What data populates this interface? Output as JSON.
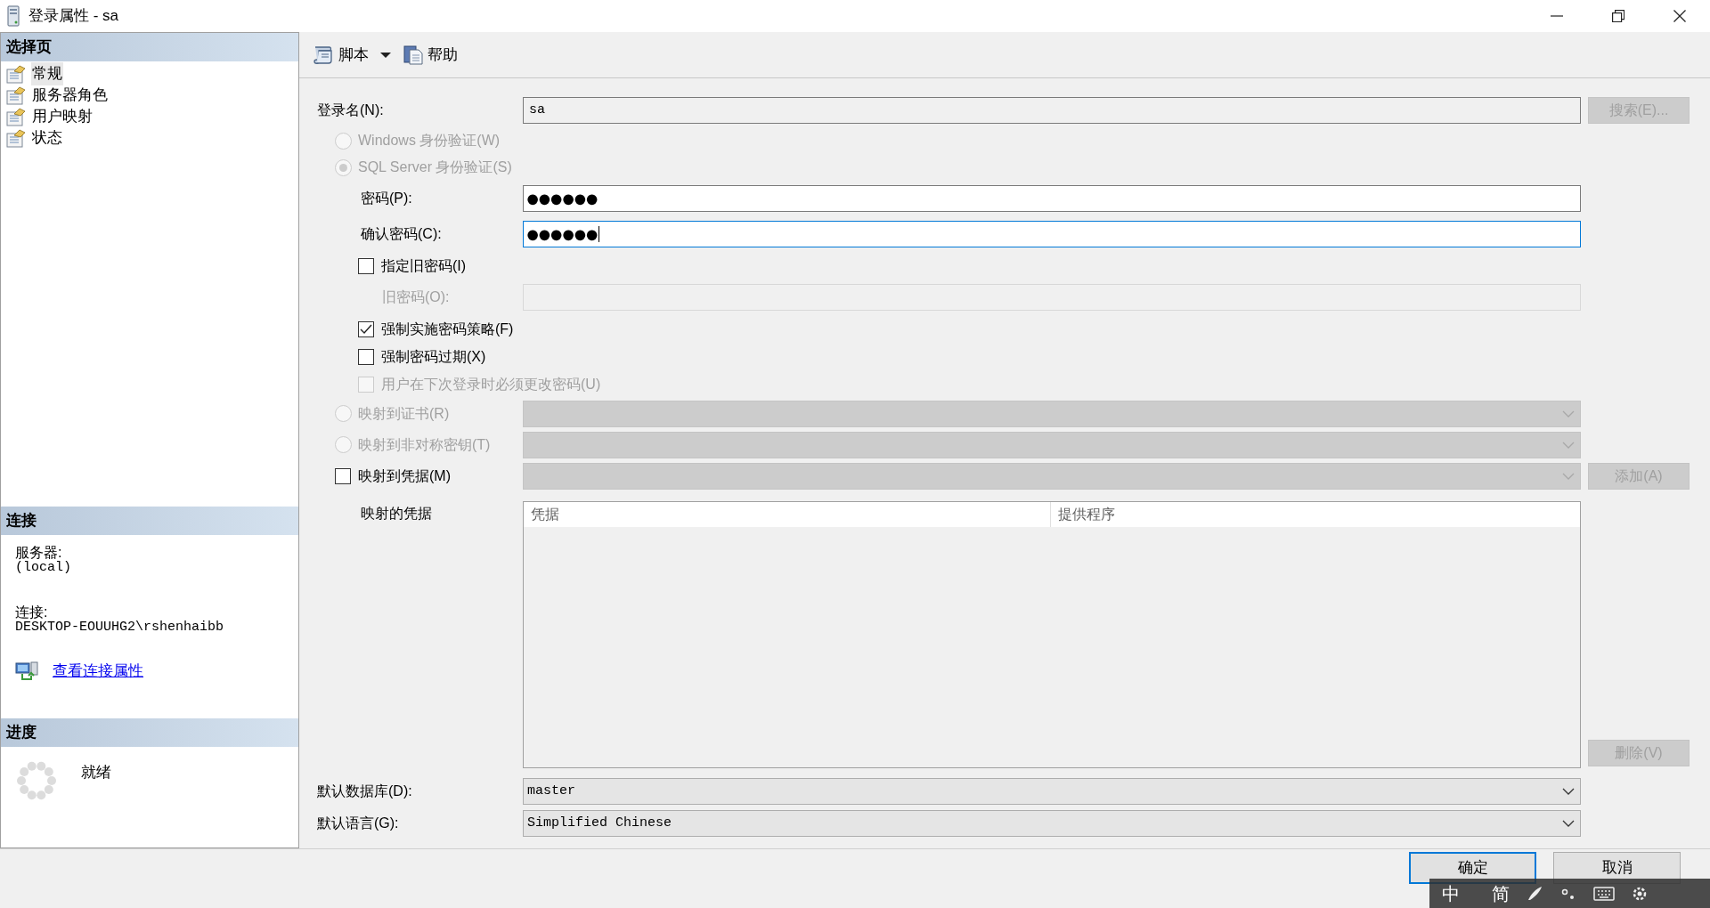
{
  "window": {
    "title": "登录属性 - sa"
  },
  "sidebar": {
    "header": "选择页",
    "pages": [
      {
        "label": "常规",
        "selected": true
      },
      {
        "label": "服务器角色",
        "selected": false
      },
      {
        "label": "用户映射",
        "selected": false
      },
      {
        "label": "状态",
        "selected": false
      }
    ]
  },
  "connection": {
    "header": "连接",
    "server_label": "服务器:",
    "server": "(local)",
    "connection_label": "连接:",
    "connection": "DESKTOP-EOUUHG2\\rshenhaibb",
    "link": "查看连接属性"
  },
  "progress": {
    "header": "进度",
    "status": "就绪"
  },
  "toolbar": {
    "script": "脚本",
    "help": "帮助"
  },
  "form": {
    "rows": [
      {
        "kind": "field",
        "label": "登录名(N):",
        "value": "sa",
        "button": "搜索(E)...",
        "button_disabled": true
      },
      {
        "kind": "radio",
        "label": "Windows 身份验证(W)",
        "selected": false,
        "disabled": true
      },
      {
        "kind": "radio",
        "label": "SQL Server 身份验证(S)",
        "selected": true,
        "disabled": true,
        "children": [
          {
            "kind": "password",
            "label": "密码(P):",
            "value": "●●●●●●",
            "focused": false,
            "disabled": false
          },
          {
            "kind": "password",
            "label": "确认密码(C):",
            "value": "●●●●●●",
            "focused": true,
            "disabled": false
          },
          {
            "kind": "checkbox",
            "label": "指定旧密码(I)",
            "checked": false,
            "disabled": false,
            "children": [
              {
                "kind": "password",
                "label": "旧密码(O):",
                "focused": false,
                "disabled": true
              }
            ]
          },
          {
            "kind": "checkbox",
            "label": "强制实施密码策略(F)",
            "checked": true,
            "disabled": false
          },
          {
            "kind": "checkbox",
            "label": "强制密码过期(X)",
            "checked": false,
            "disabled": false
          },
          {
            "kind": "checkbox",
            "label": "用户在下次登录时必须更改密码(U)",
            "checked": false,
            "disabled": true
          }
        ]
      },
      {
        "kind": "radio",
        "label": "映射到证书(R)",
        "selected": false,
        "disabled": true,
        "dropdown_disabled": true
      },
      {
        "kind": "radio",
        "label": "映射到非对称密钥(T)",
        "selected": false,
        "disabled": true,
        "dropdown_disabled": true
      },
      {
        "kind": "checkbox",
        "label": "映射到凭据(M)",
        "checked": false,
        "disabled": false,
        "dropdown_disabled": true,
        "button": "添加(A)",
        "button_disabled": true,
        "children": [
          {
            "kind": "table",
            "label": "映射的凭据",
            "columns": [
              "凭据",
              "提供程序"
            ],
            "button": "删除(V)",
            "button_disabled": true
          }
        ]
      },
      {
        "kind": "select",
        "label": "默认数据库(D):",
        "value": "master"
      },
      {
        "kind": "select",
        "label": "默认语言(G):",
        "value": "Simplified Chinese"
      }
    ]
  },
  "footer": {
    "buttons": [
      {
        "label": "确定",
        "default": true
      },
      {
        "label": "取消",
        "default": false
      }
    ]
  },
  "ime_bar": {
    "mode": "中",
    "script": "简"
  }
}
